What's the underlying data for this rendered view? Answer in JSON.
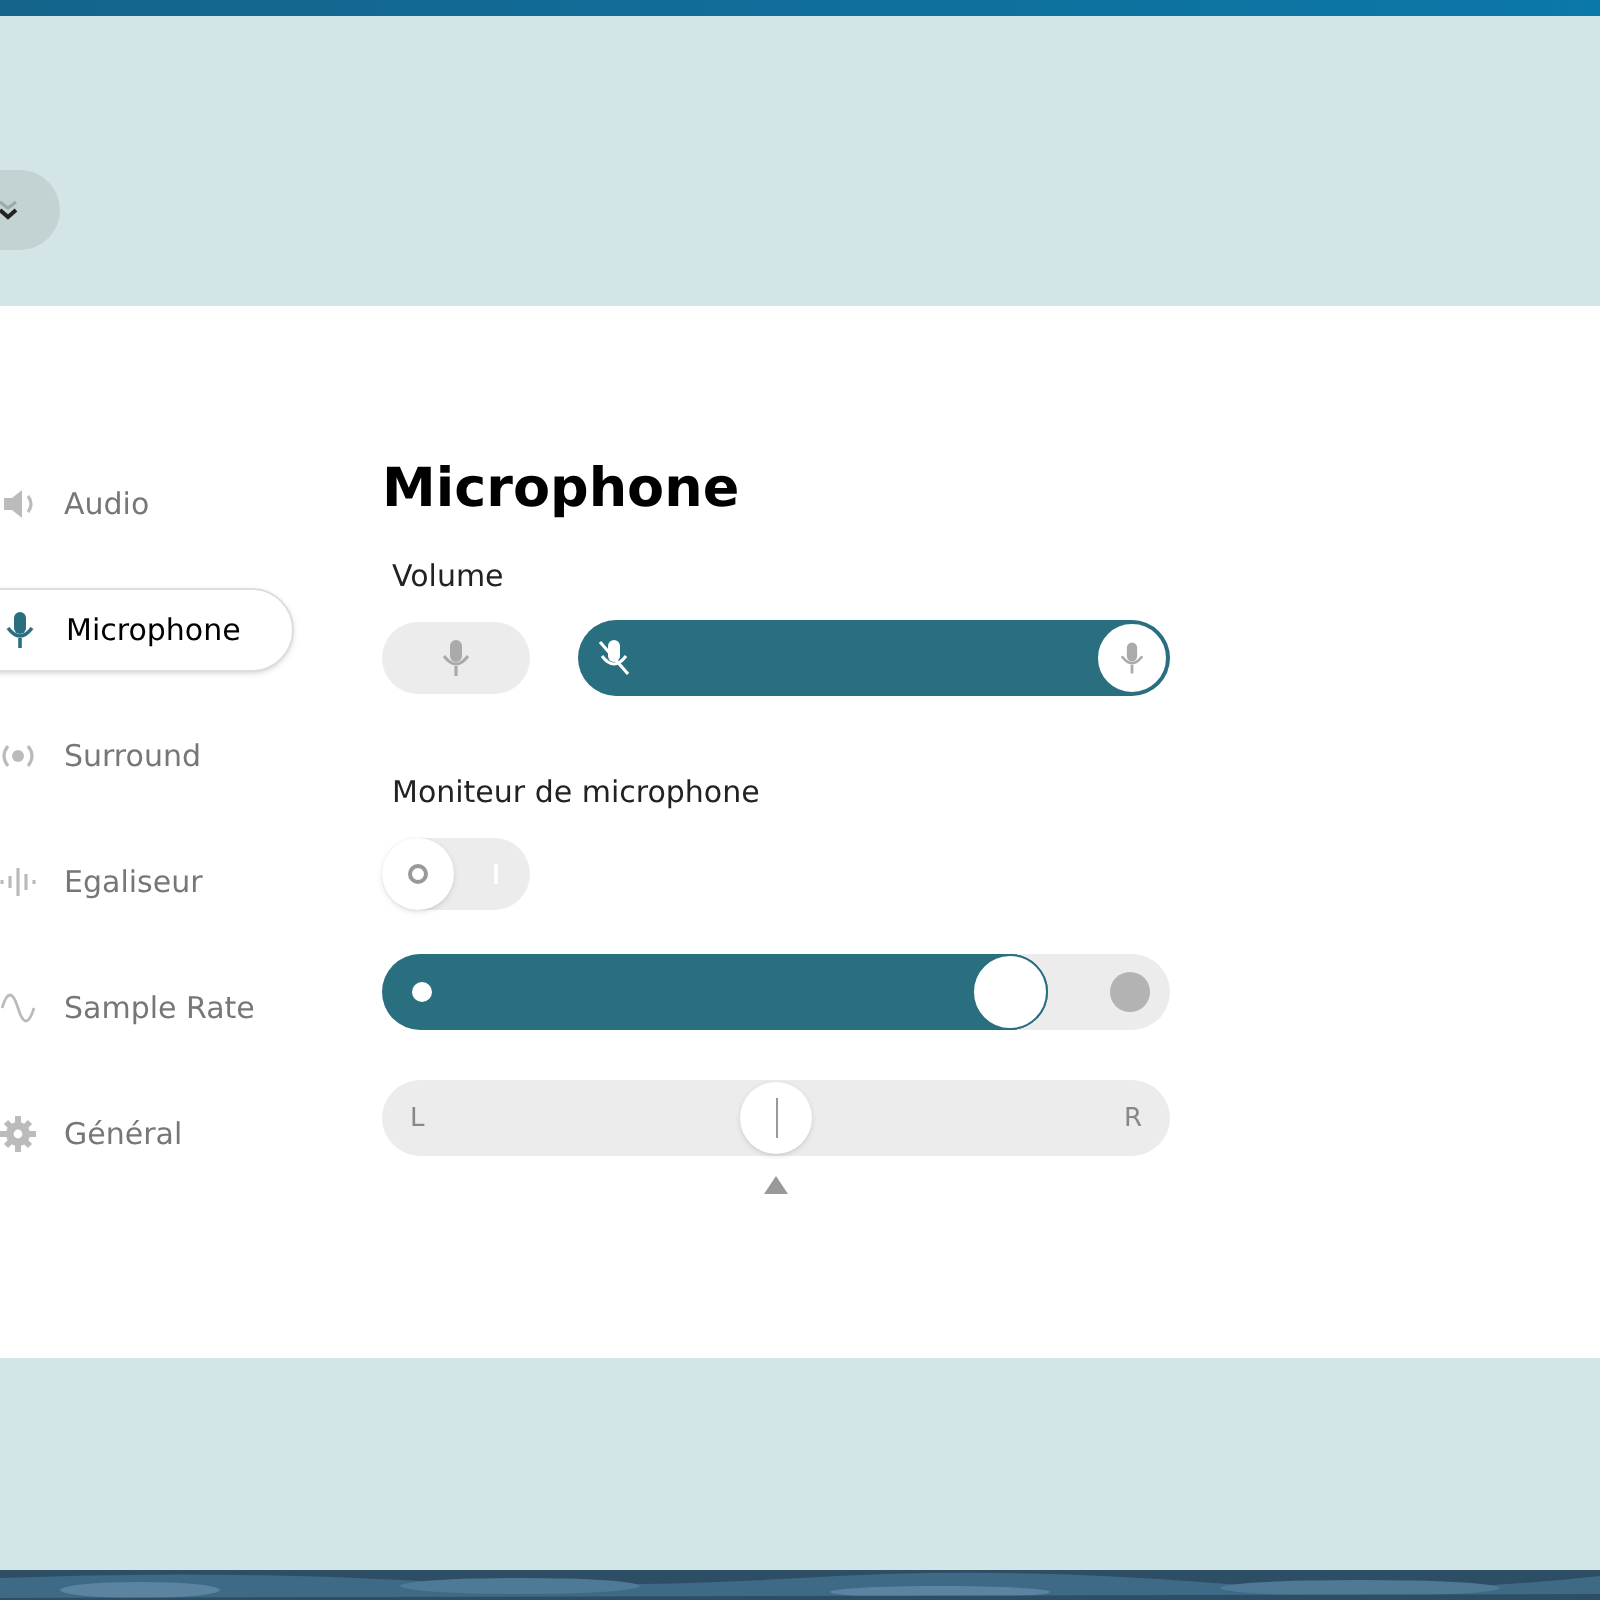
{
  "sidebar": {
    "items": [
      {
        "kind": "audio",
        "label": "Audio",
        "selected": false
      },
      {
        "kind": "microphone",
        "label": "Microphone",
        "selected": true
      },
      {
        "kind": "surround",
        "label": "Surround",
        "selected": false
      },
      {
        "kind": "equalizer",
        "label": "Egaliseur",
        "selected": false
      },
      {
        "kind": "wave",
        "label": "Sample Rate",
        "selected": false
      },
      {
        "kind": "gear",
        "label": "Général",
        "selected": false
      }
    ]
  },
  "title": "Microphone",
  "volume": {
    "label": "Volume",
    "level": 1
  },
  "monitor": {
    "label": "Moniteur de microphone",
    "on": false,
    "level": 0.83
  },
  "balance": {
    "left": "L",
    "right": "R",
    "level": 0.5
  }
}
